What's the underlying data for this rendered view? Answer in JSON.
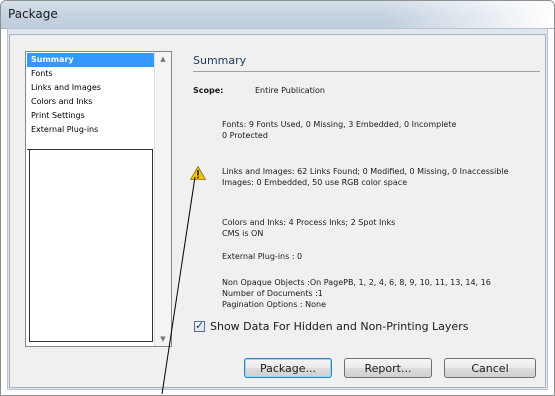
{
  "window": {
    "title": "Package"
  },
  "sidebar": {
    "items": [
      {
        "label": "Summary",
        "selected": true
      },
      {
        "label": "Fonts",
        "selected": false
      },
      {
        "label": "Links and Images",
        "selected": false
      },
      {
        "label": "Colors and Inks",
        "selected": false
      },
      {
        "label": "Print Settings",
        "selected": false
      },
      {
        "label": "External Plug-ins",
        "selected": false
      }
    ]
  },
  "summary": {
    "heading": "Summary",
    "scope_label": "Scope:",
    "scope_value": "Entire Publication",
    "fonts_line1": "Fonts: 9 Fonts Used, 0 Missing, 3 Embedded, 0 Incomplete",
    "fonts_line2": "0 Protected",
    "links_line1": "Links and Images: 62 Links Found; 0 Modified, 0 Missing, 0 Inaccessible",
    "links_line2": "Images: 0 Embedded, 50 use RGB color space",
    "colors_line1": "Colors and Inks: 4 Process Inks; 2 Spot Inks",
    "colors_line2": "CMS is ON",
    "plugins_line": "External Plug-ins : 0",
    "nonopaque_line": "Non Opaque Objects :On PagePB, 1, 2, 4, 6, 8, 9, 10, 11, 13, 14, 16",
    "documents_line": "Number of Documents :1",
    "pagination_line": "Pagination Options : None"
  },
  "options": {
    "show_hidden_label": "Show Data For Hidden and Non-Printing Layers",
    "show_hidden_checked": true
  },
  "buttons": {
    "package": "Package...",
    "report": "Report...",
    "cancel": "Cancel"
  },
  "colors": {
    "selection": "#3399ff",
    "warning": "#f5c400",
    "heading": "#1e395b"
  }
}
